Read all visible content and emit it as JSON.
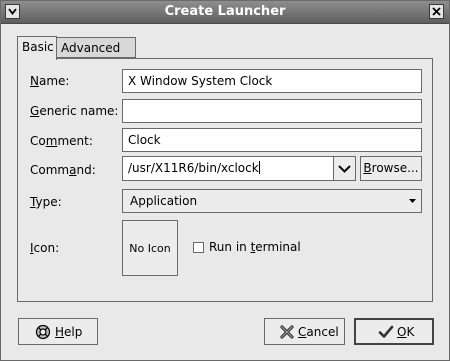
{
  "window": {
    "title": "Create Launcher"
  },
  "tabs": [
    {
      "label": "Basic",
      "active": true
    },
    {
      "label": "Advanced",
      "active": false
    }
  ],
  "form": {
    "name": {
      "label_mn": "N",
      "label_rest": "ame:",
      "value": "X Window System Clock"
    },
    "generic_name": {
      "label_mn": "G",
      "label_rest": "eneric name:",
      "value": ""
    },
    "comment": {
      "label_pre": "Co",
      "label_mn": "m",
      "label_rest": "ment:",
      "value": "Clock"
    },
    "command": {
      "label_pre": "Comm",
      "label_mn": "a",
      "label_rest": "nd:",
      "value": "/usr/X11R6/bin/xclock",
      "browse_mn": "B",
      "browse_rest": "rowse..."
    },
    "type": {
      "label_mn": "T",
      "label_rest": "ype:",
      "value": "Application"
    },
    "icon": {
      "label_mn": "I",
      "label_rest": "con:",
      "button_text": "No Icon"
    },
    "run_in_terminal": {
      "label_pre": "Run in ",
      "label_mn": "t",
      "label_rest": "erminal",
      "checked": false
    }
  },
  "buttons": {
    "help": {
      "mn": "H",
      "rest": "elp",
      "icon": "lifebuoy-icon"
    },
    "cancel": {
      "mn": "C",
      "rest": "ancel",
      "icon": "cancel-x-icon"
    },
    "ok": {
      "mn": "O",
      "rest": "K",
      "icon": "checkmark-icon"
    }
  },
  "colors": {
    "titlebar": "#6f6f6f",
    "window_bg": "#e9e9e9",
    "border": "#6a6a6a"
  }
}
